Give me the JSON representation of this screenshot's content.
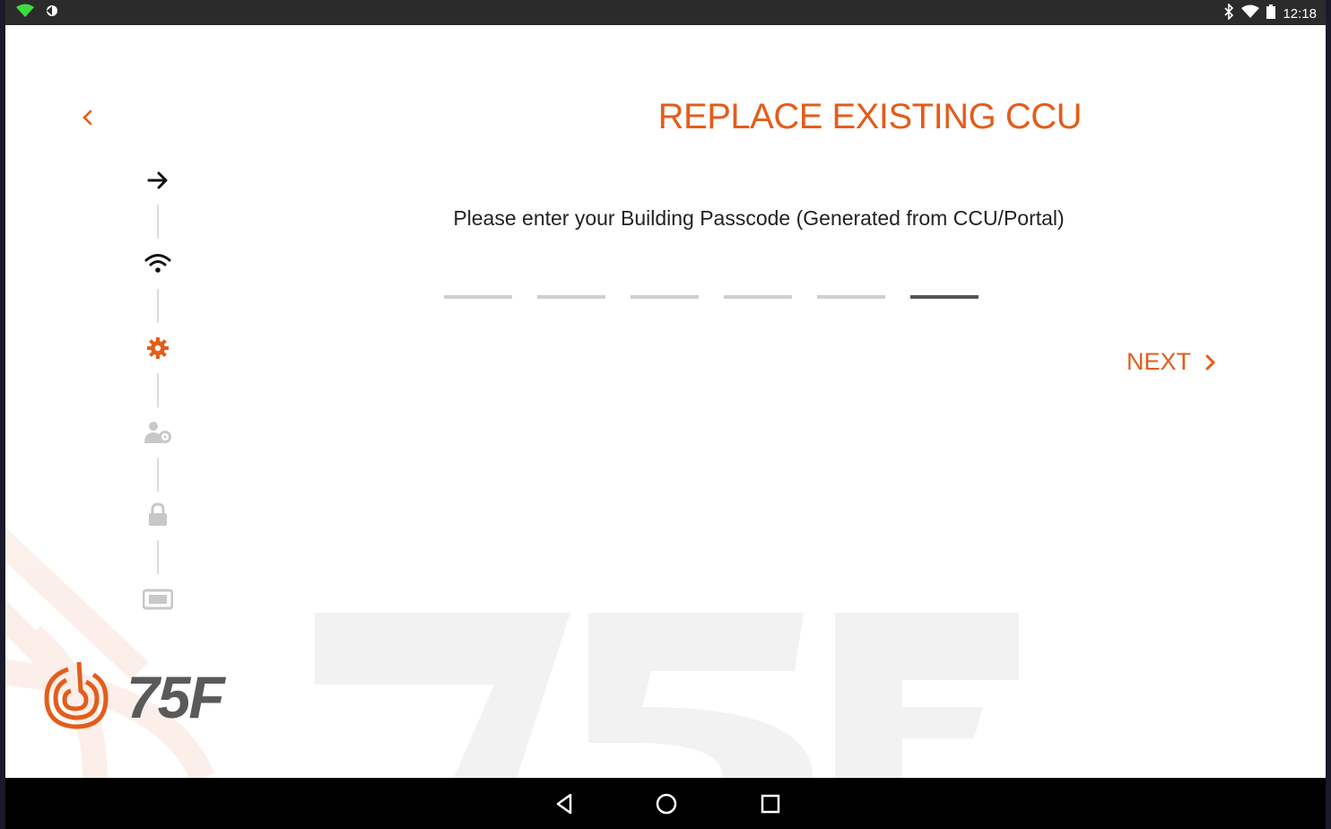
{
  "status_bar": {
    "time": "12:18",
    "left_icons": [
      "wifi-signal-icon",
      "data-saver-icon"
    ],
    "right_icons": [
      "bluetooth-icon",
      "wifi-icon",
      "battery-icon"
    ]
  },
  "header": {
    "title": "REPLACE EXISTING CCU",
    "back_icon": "chevron-left-icon"
  },
  "main": {
    "prompt": "Please enter your Building Passcode (Generated from CCU/Portal)",
    "passcode_slots": [
      "",
      "",
      "",
      "",
      "",
      ""
    ],
    "next_label": "NEXT",
    "next_icon": "chevron-right-icon"
  },
  "stepper": {
    "steps": [
      {
        "icon": "arrow-right-icon",
        "state": "done"
      },
      {
        "icon": "wifi-icon",
        "state": "done"
      },
      {
        "icon": "gear-icon",
        "state": "current"
      },
      {
        "icon": "user-settings-icon",
        "state": "pending"
      },
      {
        "icon": "lock-icon",
        "state": "pending"
      },
      {
        "icon": "device-icon",
        "state": "pending"
      }
    ]
  },
  "brand": {
    "logo_text": "75F",
    "accent_color": "#e35d1b",
    "done_color": "#111111",
    "pending_color": "#c8c8c8"
  },
  "nav_bar": {
    "buttons": [
      "back-triangle-icon",
      "home-circle-icon",
      "recents-square-icon"
    ]
  }
}
